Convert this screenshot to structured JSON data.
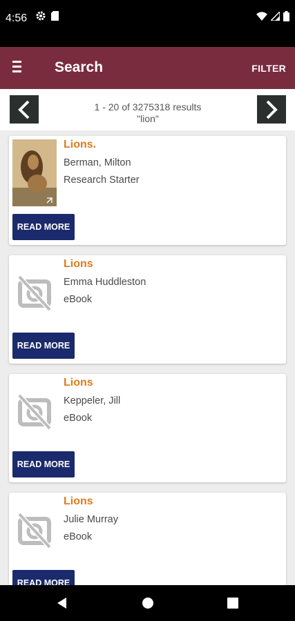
{
  "status": {
    "time": "4:56"
  },
  "header": {
    "title": "Search",
    "filter_label": "FILTER"
  },
  "results": {
    "range": "1 - 20 of 3275318 results",
    "query": "\"lion\""
  },
  "items": [
    {
      "title": "Lions.",
      "author": "Berman, Milton",
      "type": "Research Starter",
      "read_more": "READ MORE",
      "thumbnail": "lion-photo"
    },
    {
      "title": "Lions",
      "author": "Emma Huddleston",
      "type": "eBook",
      "read_more": "READ MORE",
      "thumbnail": "no-image-icon"
    },
    {
      "title": "Lions",
      "author": "Keppeler, Jill",
      "type": "eBook",
      "read_more": "READ MORE",
      "thumbnail": "no-image-icon"
    },
    {
      "title": "Lions",
      "author": "Julie Murray",
      "type": "eBook",
      "read_more": "READ MORE",
      "thumbnail": "no-image-icon"
    }
  ],
  "colors": {
    "app_bar": "#7a2c3f",
    "title_accent": "#e07b1a",
    "button": "#1a2a6c"
  }
}
